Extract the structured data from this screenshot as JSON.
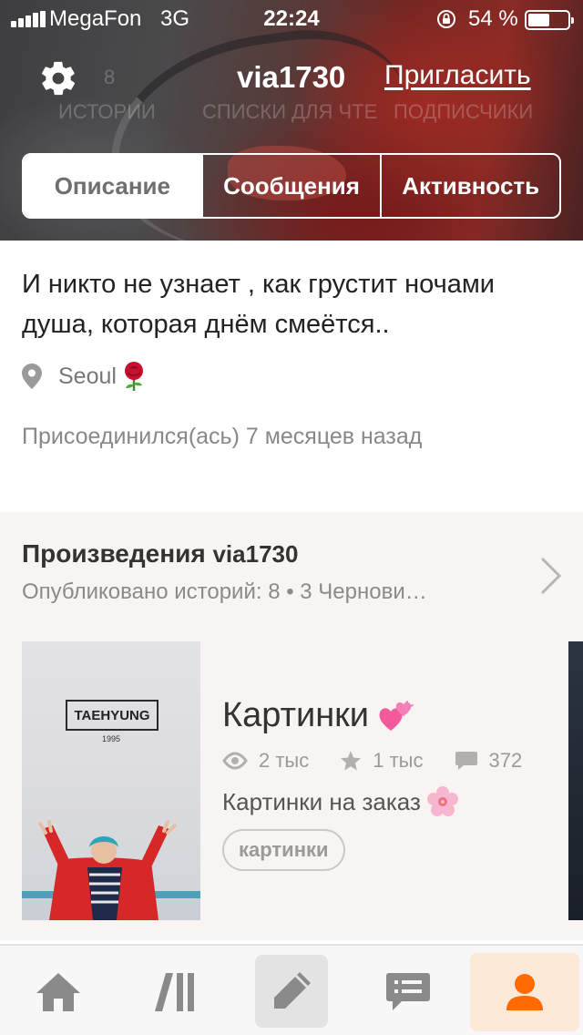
{
  "status_bar": {
    "carrier": "MegaFon",
    "network": "3G",
    "time": "22:24",
    "battery_percent": "54 %",
    "battery_level": 0.54
  },
  "header": {
    "username": "via1730",
    "invite_label": "Пригласить",
    "background_stats": [
      {
        "value": "8",
        "label": "ИСТОРИИ"
      },
      {
        "value": "",
        "label": "СПИСКИ ДЛЯ ЧТЕ"
      },
      {
        "value": "",
        "label": "ПОДПИСЧИКИ"
      }
    ],
    "tabs": [
      {
        "label": "Описание",
        "active": true
      },
      {
        "label": "Сообщения",
        "active": false
      },
      {
        "label": "Активность",
        "active": false
      }
    ]
  },
  "about": {
    "bio": "И никто не узнает , как грустит ночами душа, которая днём смеётся..",
    "location": "Seoul",
    "location_emoji": "rose",
    "joined": "Присоединился(ась) 7 месяцев назад"
  },
  "works": {
    "title": "Произведения",
    "username": "via1730",
    "subtitle": "Опубликовано историй: 8 • 3 Чернови…",
    "story": {
      "title": "Картинки",
      "title_emoji": "two-hearts",
      "reads": "2 тыс",
      "votes": "1 тыс",
      "comments": "372",
      "description": "Картинки на заказ",
      "description_emoji": "cherry-blossom",
      "tag": "картинки",
      "cover": {
        "title": "TAEHYUNG",
        "year": "1995"
      }
    }
  },
  "tabbar": {
    "items": [
      "home-icon",
      "library-icon",
      "write-icon",
      "messages-icon",
      "profile-icon"
    ],
    "active": "profile-icon",
    "accent": "#ff6b00"
  }
}
